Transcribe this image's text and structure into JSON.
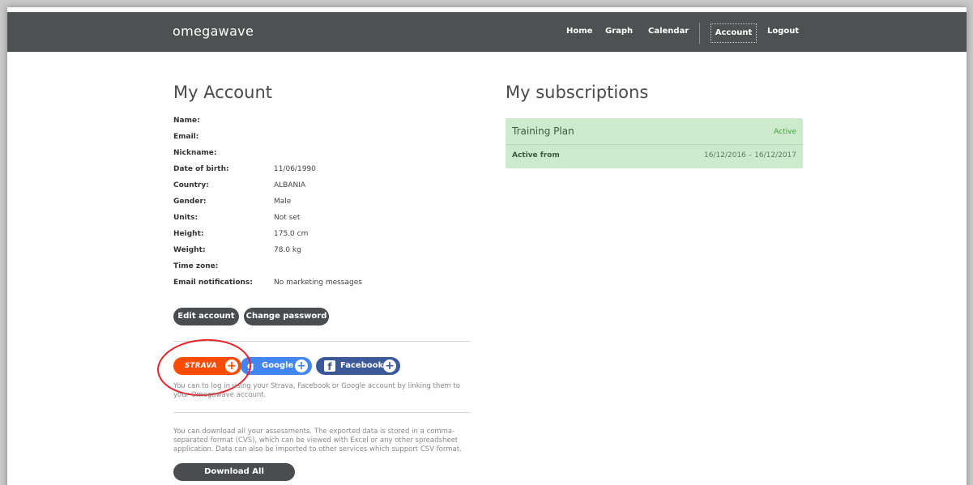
{
  "app": {
    "logo": "omegawave"
  },
  "nav": {
    "home": "Home",
    "graph": "Graph",
    "calendar": "Calendar",
    "account": "Account",
    "logout": "Logout"
  },
  "account": {
    "title": "My Account",
    "rows": [
      {
        "label": "Name:",
        "value": ""
      },
      {
        "label": "Email:",
        "value": ""
      },
      {
        "label": "Nickname:",
        "value": ""
      },
      {
        "label": "Date of birth:",
        "value": "11/06/1990"
      },
      {
        "label": "Country:",
        "value": "ALBANIA"
      },
      {
        "label": "Gender:",
        "value": "Male"
      },
      {
        "label": "Units:",
        "value": "Not set"
      },
      {
        "label": "Height:",
        "value": "175.0 cm"
      },
      {
        "label": "Weight:",
        "value": "78.0 kg"
      },
      {
        "label": "Time zone:",
        "value": ""
      },
      {
        "label": "Email notifications:",
        "value": "No marketing messages"
      }
    ],
    "edit_button": "Edit account",
    "password_button": "Change password"
  },
  "social": {
    "strava": "STRAVA",
    "google": "Google",
    "facebook": "Facebook",
    "note": "You can to log in using your Strava, Facebook or Google account by linking them to your Omegawave account."
  },
  "export": {
    "note": "You can download all your assessments. The exported data is stored in a comma-separated format (CVS), which can be viewed with Excel or any other spreadsheet application. Data can also be imported to other services which support CSV format.",
    "button": "Download All Assessments"
  },
  "subscriptions": {
    "title": "My subscriptions",
    "plan": "Training Plan",
    "status": "Active",
    "from_label": "Active from",
    "dates": "16/12/2016 – 16/12/2017"
  },
  "colors": {
    "navbar": "#4e5152",
    "strava": "#fc4c02",
    "google": "#4285f4",
    "facebook": "#3b5998",
    "subscription_bg": "#ccebcc",
    "annotation": "#e8202a"
  }
}
